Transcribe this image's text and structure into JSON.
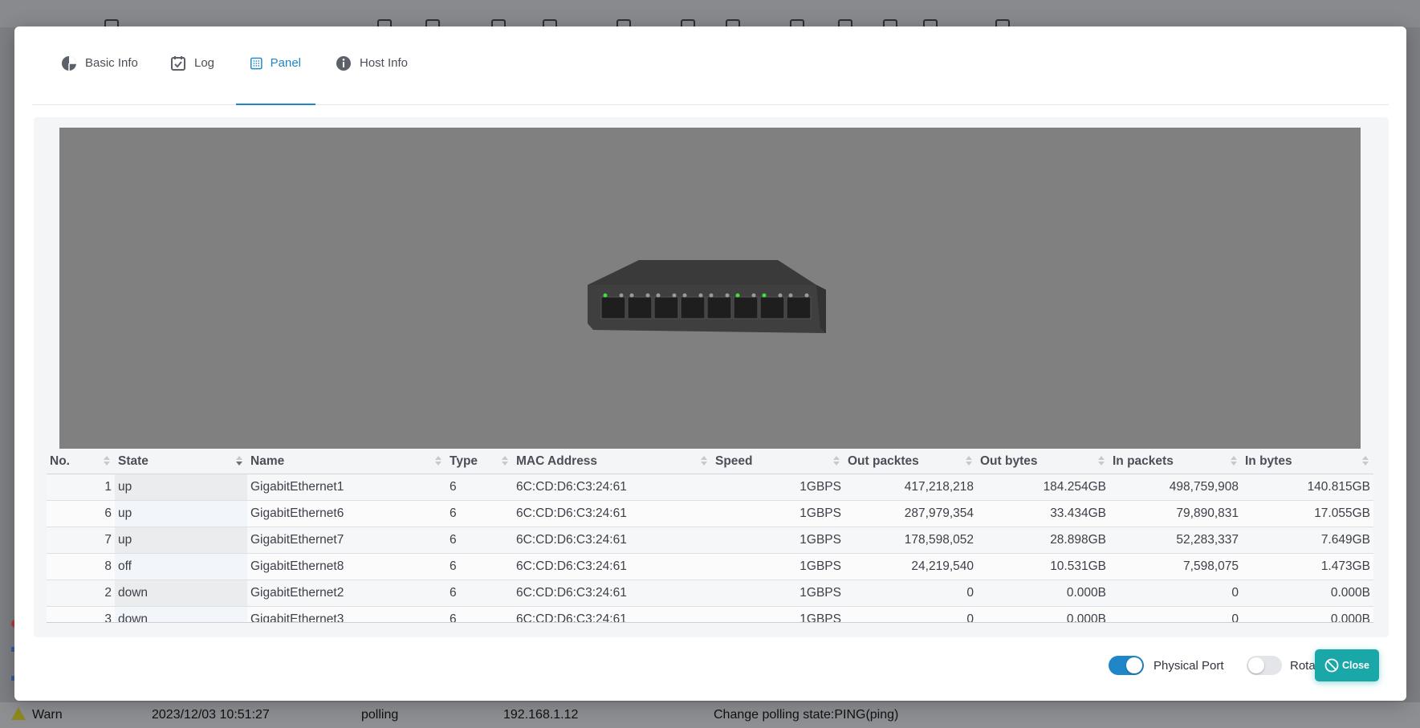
{
  "background": {
    "warn_row": {
      "level": "Warn",
      "time": "2023/12/03 10:51:27",
      "source": "polling",
      "ip": "192.168.1.12",
      "message": "Change polling state:PING(ping)"
    }
  },
  "tabs": [
    {
      "label": "Basic Info",
      "icon": "pie-chart-icon",
      "active": false
    },
    {
      "label": "Log",
      "icon": "calendar-check-icon",
      "active": false
    },
    {
      "label": "Panel",
      "icon": "grid-icon",
      "active": true
    },
    {
      "label": "Host Info",
      "icon": "info-icon",
      "active": false
    }
  ],
  "table": {
    "columns": [
      "No.",
      "State",
      "Name",
      "Type",
      "MAC Address",
      "Speed",
      "Out packtes",
      "Out bytes",
      "In packets",
      "In bytes"
    ],
    "rows": [
      [
        "1",
        "up",
        "GigabitEthernet1",
        "6",
        "6C:CD:D6:C3:24:61",
        "1GBPS",
        "417,218,218",
        "184.254GB",
        "498,759,908",
        "140.815GB"
      ],
      [
        "6",
        "up",
        "GigabitEthernet6",
        "6",
        "6C:CD:D6:C3:24:61",
        "1GBPS",
        "287,979,354",
        "33.434GB",
        "79,890,831",
        "17.055GB"
      ],
      [
        "7",
        "up",
        "GigabitEthernet7",
        "6",
        "6C:CD:D6:C3:24:61",
        "1GBPS",
        "178,598,052",
        "28.898GB",
        "52,283,337",
        "7.649GB"
      ],
      [
        "8",
        "off",
        "GigabitEthernet8",
        "6",
        "6C:CD:D6:C3:24:61",
        "1GBPS",
        "24,219,540",
        "10.531GB",
        "7,598,075",
        "1.473GB"
      ],
      [
        "2",
        "down",
        "GigabitEthernet2",
        "6",
        "6C:CD:D6:C3:24:61",
        "1GBPS",
        "0",
        "0.000B",
        "0",
        "0.000B"
      ],
      [
        "3",
        "down",
        "GigabitEthernet3",
        "6",
        "6C:CD:D6:C3:24:61",
        "1GBPS",
        "0",
        "0.000B",
        "0",
        "0.000B"
      ]
    ]
  },
  "footer": {
    "physical_port_label": "Physical Port",
    "physical_port_on": true,
    "rotate_label": "Rotate",
    "rotate_on": false,
    "close_label": "Close"
  },
  "colors": {
    "accent": "#1f86c8",
    "close_button": "#1aa7a7",
    "port_led_green": "#3ee03e"
  }
}
